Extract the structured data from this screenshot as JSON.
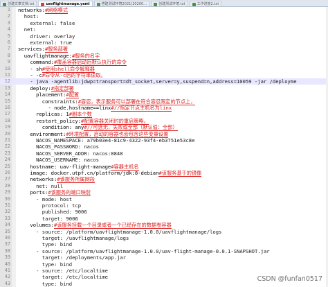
{
  "tabs": [
    {
      "label": "创建文章文档.txt",
      "active": false
    },
    {
      "label": "uavflightmanage.yaml",
      "active": true
    },
    {
      "label": "搭建测试环境2021(20200…",
      "active": false
    },
    {
      "label": "创建测试环境.txt",
      "active": false
    },
    {
      "label": "工作进度2.txt",
      "active": false
    }
  ],
  "lines": [
    {
      "num": "1",
      "indent": 0,
      "text": "networks:#网络模式"
    },
    {
      "num": "2",
      "indent": 2,
      "text": "host:"
    },
    {
      "num": "3",
      "indent": 4,
      "text": "external: false"
    },
    {
      "num": "4",
      "indent": 2,
      "text": "net:"
    },
    {
      "num": "5",
      "indent": 4,
      "text": "driver: overlay"
    },
    {
      "num": "6",
      "indent": 4,
      "text": "external: true"
    },
    {
      "num": "7",
      "indent": 0,
      "text": "services:#服务部署"
    },
    {
      "num": "8",
      "indent": 2,
      "text": "uavflightmanage:#服务的名字"
    },
    {
      "num": "9",
      "indent": 4,
      "text": "command:#覆盖容器启动后默认执行的命令"
    },
    {
      "num": "10",
      "indent": 4,
      "text": "- sh#使用shell命令解释器"
    },
    {
      "num": "11",
      "indent": 4,
      "text": "- -c#命令从-c后的字符串读取。"
    },
    {
      "num": "12",
      "indent": 4,
      "text": "- java -agentlib:jdwp=transport=dt_socket,server=y,suspend=n,address=10059 -jar /deployme"
    },
    {
      "num": "13",
      "indent": 4,
      "text": "deploy:#指定部署"
    },
    {
      "num": "14",
      "indent": 6,
      "text": "placement:#配置"
    },
    {
      "num": "15",
      "indent": 8,
      "text": "constraints:#容忍，表示服务可以部署在符合容忍限定的节点上，"
    },
    {
      "num": "16",
      "indent": 10,
      "text": "- node.hostname==linx#//指定节点主机名为linx"
    },
    {
      "num": "17",
      "indent": 6,
      "text": "replicas: 1#副本个数"
    },
    {
      "num": "18",
      "indent": 6,
      "text": "restart_policy:#配置容器关闭时的重启策略。"
    },
    {
      "num": "19",
      "indent": 8,
      "text": "condition: any#//可选无，失败或全部（默认值：全部）"
    },
    {
      "num": "20",
      "indent": 4,
      "text": "environment:#环境配置，启动的容器也会包含这些变量设置"
    },
    {
      "num": "21",
      "indent": 6,
      "text": "NACOS_NAMESPACE: a79b03e4-81c9-4322-93f4-eb3751e53c8e"
    },
    {
      "num": "22",
      "indent": 6,
      "text": "NACOS_PASSWORD: nacos"
    },
    {
      "num": "23",
      "indent": 6,
      "text": "NACOS_SERVER_ADDR: nacos:8848"
    },
    {
      "num": "24",
      "indent": 6,
      "text": "NACOS_USERNAME: nacos"
    },
    {
      "num": "25",
      "indent": 4,
      "text": "hostname: uav-flight-manage#容器主机名"
    },
    {
      "num": "26",
      "indent": 4,
      "text": "image: docker.utpf.cn/platform/jdk:8-debian#该服务基于的镜像"
    },
    {
      "num": "27",
      "indent": 4,
      "text": "networks:#该服务所属网段"
    },
    {
      "num": "28",
      "indent": 6,
      "text": "net: null"
    },
    {
      "num": "29",
      "indent": 4,
      "text": "ports:#该服务的端口映射"
    },
    {
      "num": "30",
      "indent": 6,
      "text": "- mode: host"
    },
    {
      "num": "31",
      "indent": 8,
      "text": "protocol: tcp"
    },
    {
      "num": "32",
      "indent": 8,
      "text": "published: 9006"
    },
    {
      "num": "33",
      "indent": 8,
      "text": "target: 9006"
    },
    {
      "num": "34",
      "indent": 4,
      "text": "volumes:#该服务挂载一个目录或者一个已经存在的数据卷容器"
    },
    {
      "num": "35",
      "indent": 6,
      "text": "- source: /platform/uavflightmanage-1.0.0/uavflightmanage/logs"
    },
    {
      "num": "36",
      "indent": 8,
      "text": "target: /uavflightmanage/logs"
    },
    {
      "num": "37",
      "indent": 8,
      "text": "type: bind"
    },
    {
      "num": "38",
      "indent": 6,
      "text": "- source: /platform/uavflightmanage-1.0.0/uav-flight-manage-0.0.1-SNAPSHOT.jar"
    },
    {
      "num": "39",
      "indent": 8,
      "text": "target: /deployments/app.jar"
    },
    {
      "num": "40",
      "indent": 8,
      "text": "type: bind"
    },
    {
      "num": "41",
      "indent": 6,
      "text": "- source: /etc/localtime"
    },
    {
      "num": "42",
      "indent": 8,
      "text": "target: /etc/localtime"
    },
    {
      "num": "43",
      "indent": 8,
      "text": "type: bind"
    }
  ],
  "highlighted_line": "12",
  "watermark": "CSDN @funfan0517"
}
